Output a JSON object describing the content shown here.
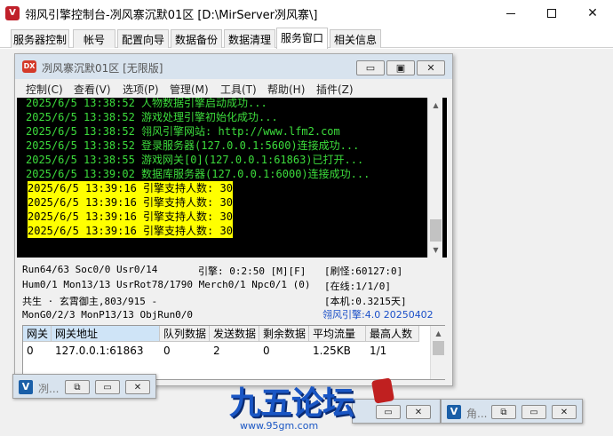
{
  "window": {
    "title": "翎风引擎控制台-冽风寨沉默01区 [D:\\MirServer冽风寨\\]"
  },
  "tabs": [
    {
      "label": "服务器控制",
      "active": false
    },
    {
      "label": "帐号",
      "active": false
    },
    {
      "label": "配置向导",
      "active": false
    },
    {
      "label": "数据备份",
      "active": false
    },
    {
      "label": "数据清理",
      "active": false
    },
    {
      "label": "服务窗口",
      "active": true
    },
    {
      "label": "相关信息",
      "active": false
    }
  ],
  "mdi": {
    "icon_text": "DX",
    "title": "冽风寨沉默01区 [无限版]",
    "menu": [
      "控制(C)",
      "查看(V)",
      "选项(P)",
      "管理(M)",
      "工具(T)",
      "帮助(H)",
      "插件(Z)"
    ],
    "log": [
      {
        "text": "2025/6/5 13:38:52 人物数据引擎启动成功...",
        "highlight": false
      },
      {
        "text": "2025/6/5 13:38:52 游戏处理引擎初始化成功...",
        "highlight": false
      },
      {
        "text": "2025/6/5 13:38:52 翎风引擎网站: http://www.lfm2.com",
        "highlight": false
      },
      {
        "text": "2025/6/5 13:38:52 登录服务器(127.0.0.1:5600)连接成功...",
        "highlight": false
      },
      {
        "text": "2025/6/5 13:38:55 游戏网关[0](127.0.0.1:61863)已打开...",
        "highlight": false
      },
      {
        "text": "2025/6/5 13:39:02 数据库服务器(127.0.0.1:6000)连接成功...",
        "highlight": false
      },
      {
        "text": "2025/6/5 13:39:16 引擎支持人数: 30",
        "highlight": true
      },
      {
        "text": "2025/6/5 13:39:16 引擎支持人数: 30",
        "highlight": true
      },
      {
        "text": "2025/6/5 13:39:16 引擎支持人数: 30",
        "highlight": true
      },
      {
        "text": "2025/6/5 13:39:16 引擎支持人数: 30",
        "highlight": true
      }
    ],
    "status": {
      "run": "Run64/63 Soc0/0 Usr0/14",
      "engine": "引擎: 0:2:50 [M][F]",
      "refresh": "[刷怪:60127:0]",
      "hum": "Hum0/1 Mon13/13 UsrRot78/1790 Merch0/1 Npc0/1 (0)",
      "online": "[在线:1/1/0]",
      "gong": "共生 · 玄霄御主,803/915 -",
      "machine": "[本机:0.3215天]",
      "mon": "MonG0/2/3 MonP13/13 ObjRun0/0",
      "version": "翎风引擎:4.0 20250402"
    },
    "grid": {
      "headers": [
        "网关",
        "网关地址",
        "队列数据",
        "发送数据",
        "剩余数据",
        "平均流量",
        "最高人数"
      ],
      "rows": [
        [
          "0",
          "127.0.0.1:61863",
          "0",
          "2",
          "0",
          "1.25KB",
          "1/1"
        ]
      ]
    }
  },
  "minimized": [
    {
      "icon_text": "V",
      "title": "冽..."
    },
    {
      "icon_text": "V",
      "title": "角..."
    }
  ],
  "watermark": {
    "brand": "九五论坛",
    "url": "www.95gm.com"
  }
}
